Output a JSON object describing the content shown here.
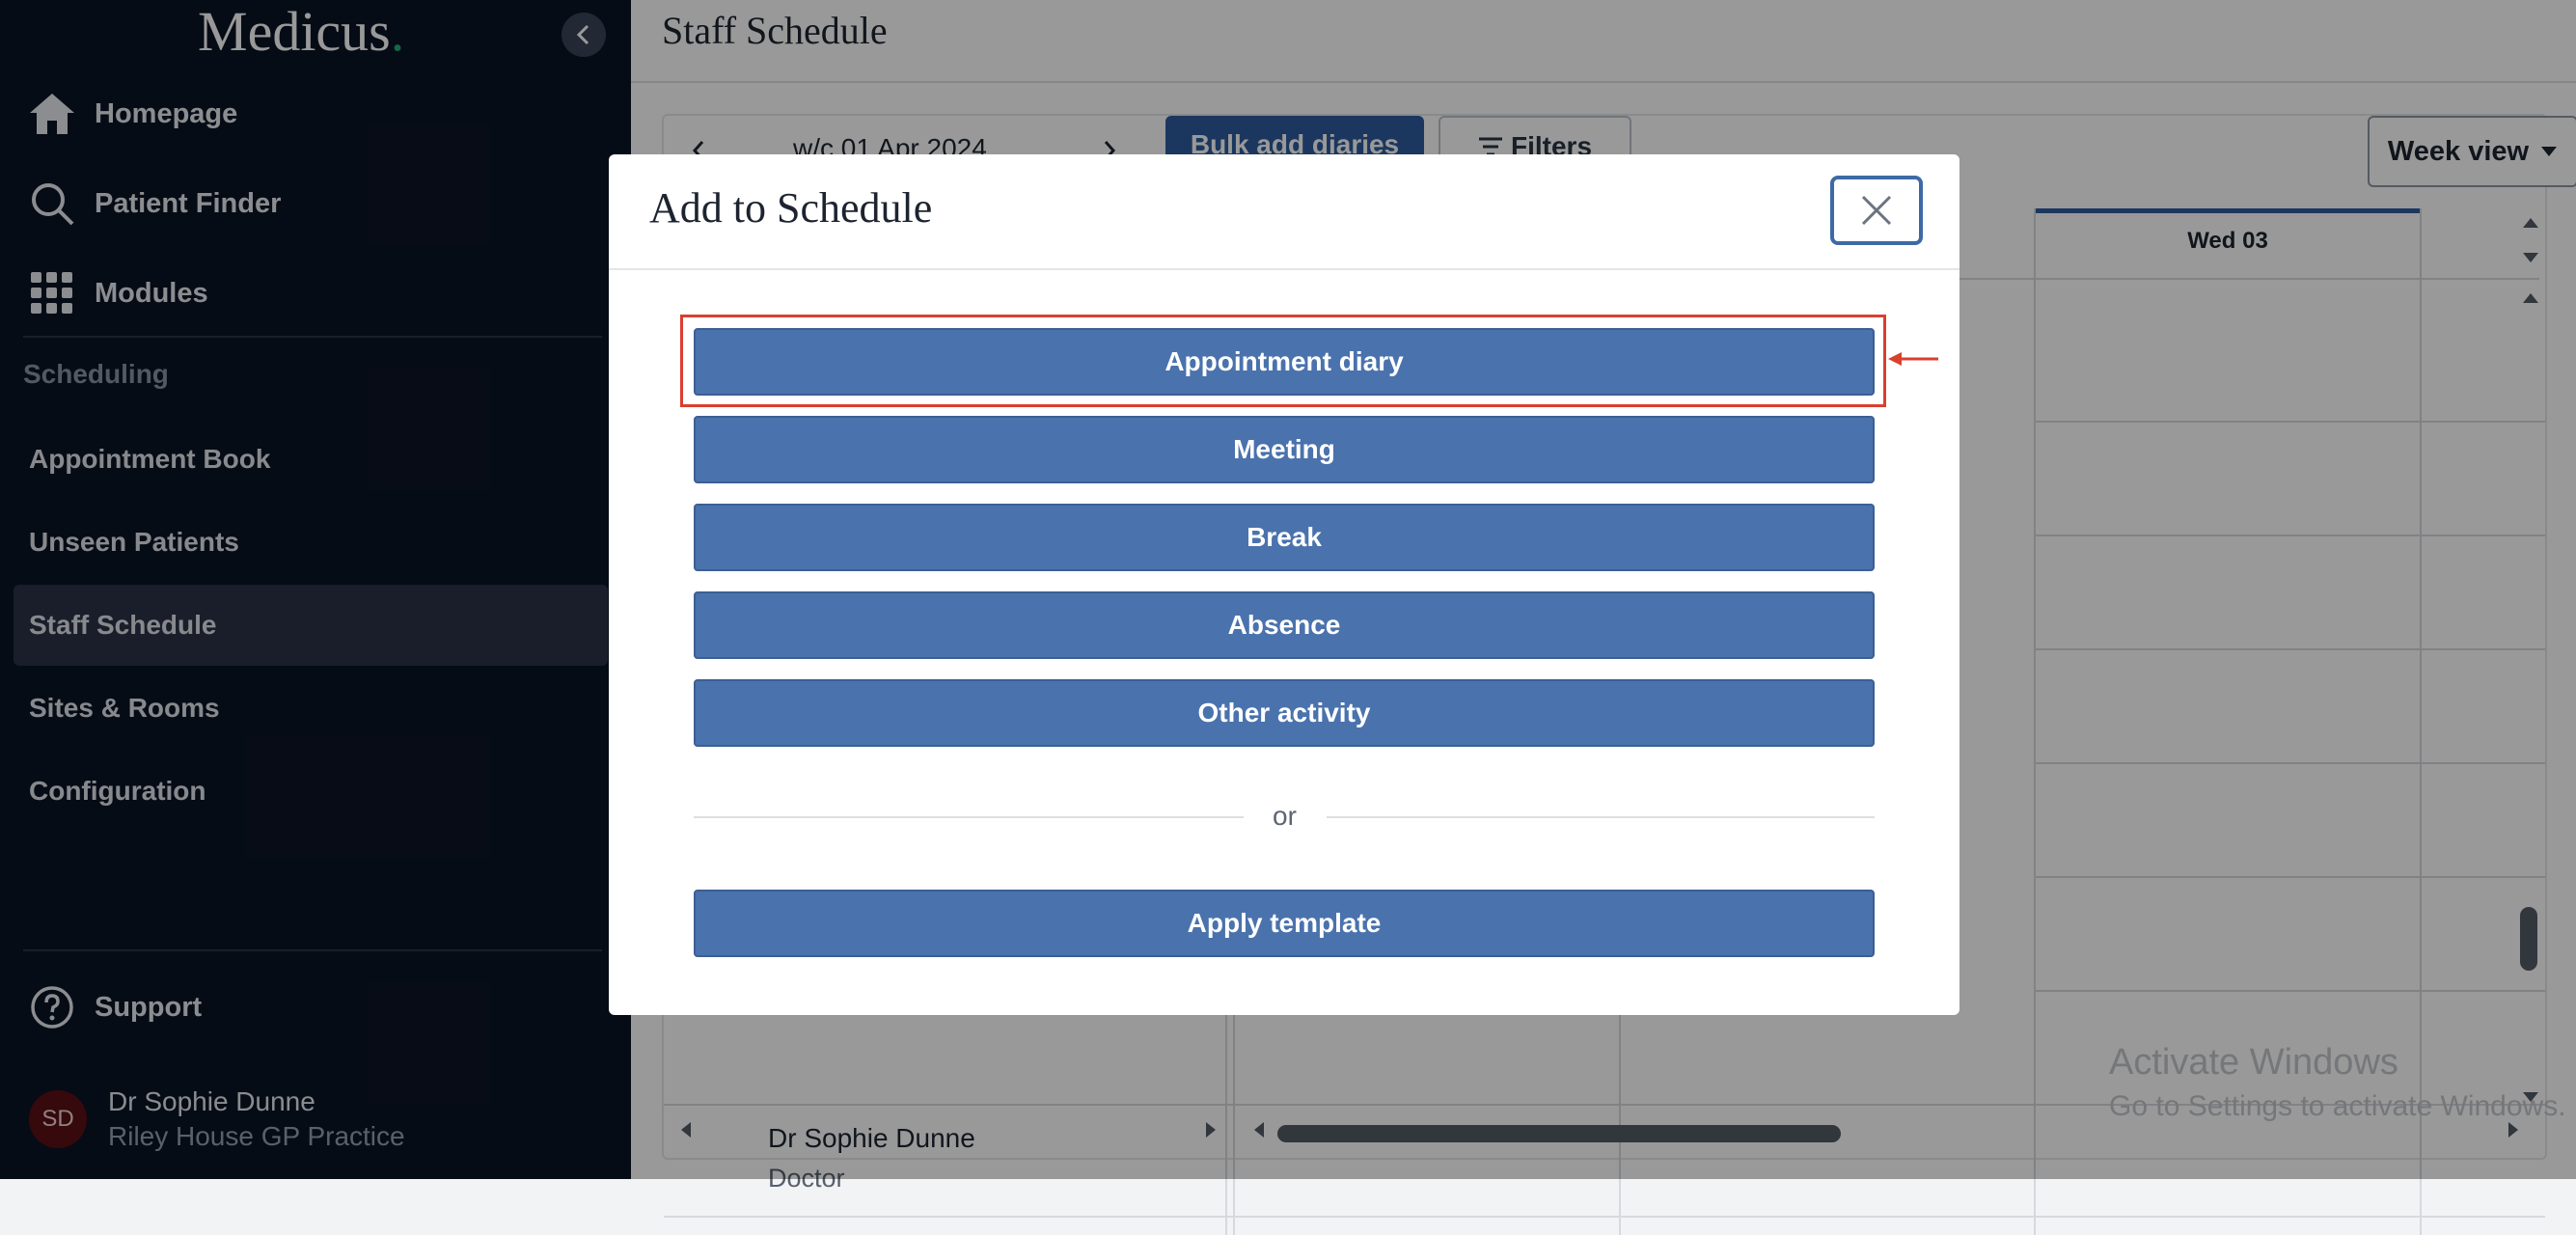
{
  "brand": {
    "name": "Medicus",
    "dot": "."
  },
  "sidebar": {
    "nav": [
      {
        "label": "Homepage",
        "icon": "home-icon"
      },
      {
        "label": "Patient Finder",
        "icon": "search-icon"
      },
      {
        "label": "Modules",
        "icon": "grid-icon"
      }
    ],
    "section": "Scheduling",
    "items": [
      {
        "label": "Appointment Book"
      },
      {
        "label": "Unseen Patients"
      },
      {
        "label": "Staff Schedule",
        "active": true
      },
      {
        "label": "Sites & Rooms"
      },
      {
        "label": "Configuration"
      }
    ],
    "support": "Support",
    "user": {
      "initials": "SD",
      "name": "Dr Sophie Dunne",
      "org": "Riley House GP Practice"
    }
  },
  "main": {
    "title": "Staff Schedule",
    "week_label": "w/c 01 Apr 2024",
    "bulk_add": "Bulk add diaries",
    "filters": "Filters",
    "view_select": "Week view",
    "day_header": "Wed 03",
    "staff": {
      "name": "Dr Sophie Dunne",
      "role": "Doctor"
    },
    "watermark": {
      "line1": "Activate Windows",
      "line2": "Go to Settings to activate Windows."
    }
  },
  "modal": {
    "title": "Add to Schedule",
    "options": [
      "Appointment diary",
      "Meeting",
      "Break",
      "Absence",
      "Other activity"
    ],
    "divider": "or",
    "apply_template": "Apply template"
  },
  "colors": {
    "sidebar_bg": "#0b1426",
    "primary": "#4a72ad",
    "highlight": "#d9402e",
    "accent_green": "#2aa878"
  }
}
